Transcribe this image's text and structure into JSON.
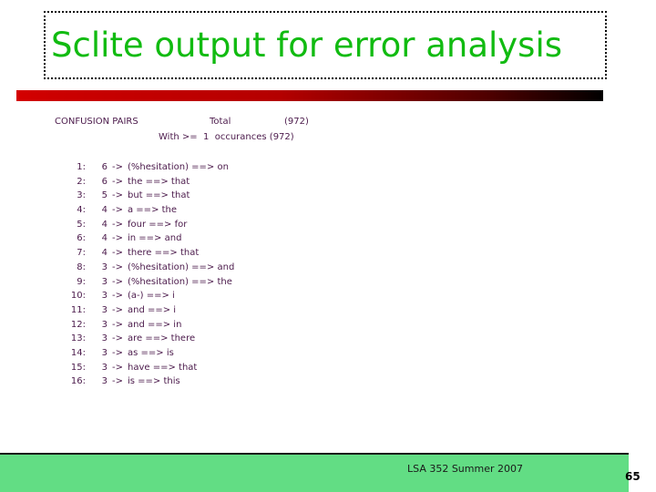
{
  "slide": {
    "title": "Sclite output for error analysis",
    "title_color": "#11bb11",
    "accent_bar_from": "#d40000",
    "accent_bar_to": "#000000"
  },
  "report": {
    "header": {
      "label": "CONFUSION PAIRS",
      "total_label": "Total",
      "total_count": "(972)",
      "threshold_line": "With >=  1  occurances (972)"
    },
    "text_color": "#4b1a4b",
    "rows": [
      {
        "rank": "1:",
        "count": "6",
        "arrow": "->",
        "pair": "(%hesitation) ==> on"
      },
      {
        "rank": "2:",
        "count": "6",
        "arrow": "->",
        "pair": "the ==> that"
      },
      {
        "rank": "3:",
        "count": "5",
        "arrow": "->",
        "pair": "but ==> that"
      },
      {
        "rank": "4:",
        "count": "4",
        "arrow": "->",
        "pair": "a ==> the"
      },
      {
        "rank": "5:",
        "count": "4",
        "arrow": "->",
        "pair": "four ==> for"
      },
      {
        "rank": "6:",
        "count": "4",
        "arrow": "->",
        "pair": "in ==> and"
      },
      {
        "rank": "7:",
        "count": "4",
        "arrow": "->",
        "pair": "there ==> that"
      },
      {
        "rank": "8:",
        "count": "3",
        "arrow": "->",
        "pair": "(%hesitation) ==> and"
      },
      {
        "rank": "9:",
        "count": "3",
        "arrow": "->",
        "pair": "(%hesitation) ==> the"
      },
      {
        "rank": "10:",
        "count": "3",
        "arrow": "->",
        "pair": "(a-) ==> i"
      },
      {
        "rank": "11:",
        "count": "3",
        "arrow": "->",
        "pair": "and ==> i"
      },
      {
        "rank": "12:",
        "count": "3",
        "arrow": "->",
        "pair": "and ==> in"
      },
      {
        "rank": "13:",
        "count": "3",
        "arrow": "->",
        "pair": "are ==> there"
      },
      {
        "rank": "14:",
        "count": "3",
        "arrow": "->",
        "pair": "as ==> is"
      },
      {
        "rank": "15:",
        "count": "3",
        "arrow": "->",
        "pair": "have ==> that"
      },
      {
        "rank": "16:",
        "count": "3",
        "arrow": "->",
        "pair": "is ==> this"
      }
    ]
  },
  "footer": {
    "course_text": "LSA 352 Summer 2007",
    "page_number": "65",
    "band_color": "#62dd84"
  }
}
